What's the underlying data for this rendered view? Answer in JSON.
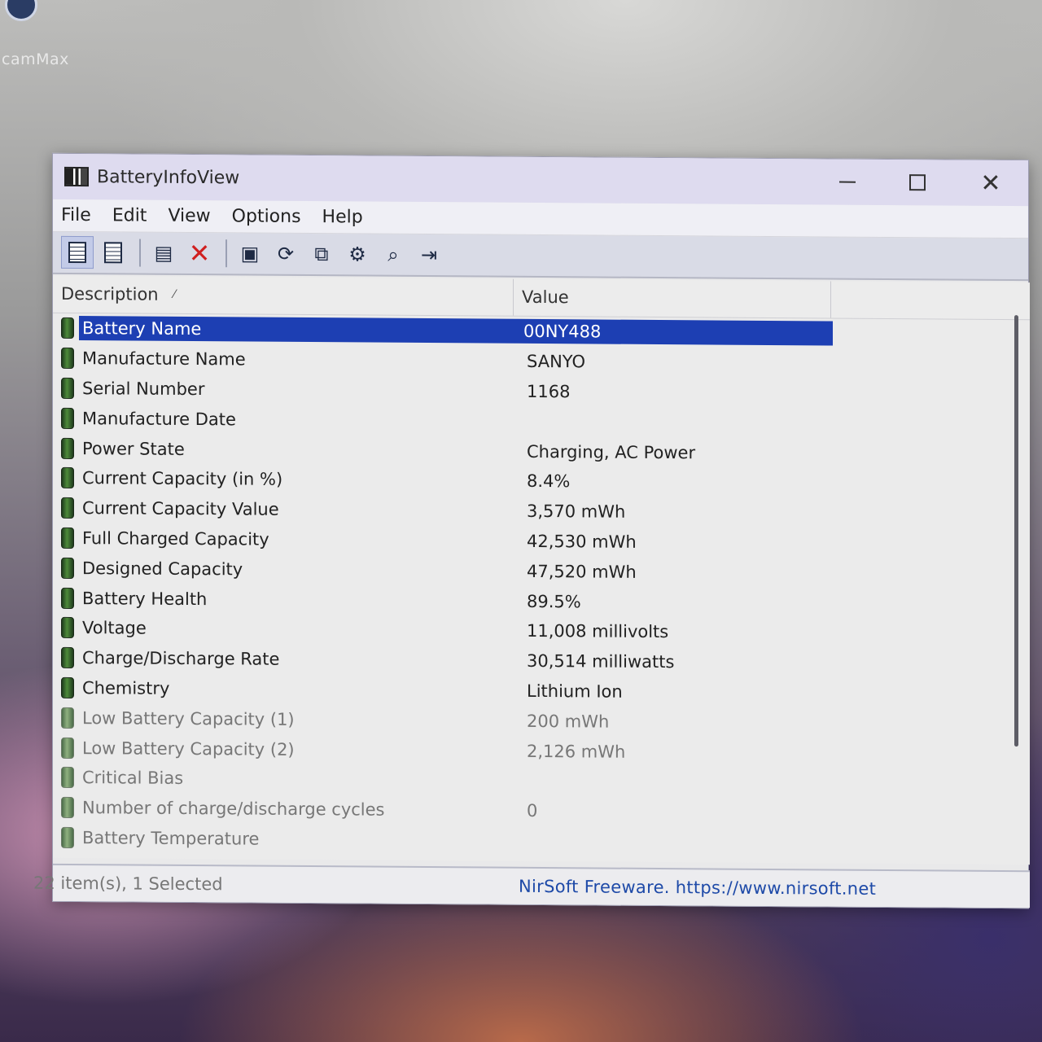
{
  "desktop": {
    "icon_label": "camMax"
  },
  "window": {
    "title": "BatteryInfoView",
    "caption": {
      "close": "✕"
    }
  },
  "menu": [
    "File",
    "Edit",
    "View",
    "Options",
    "Help"
  ],
  "toolbar": {
    "buttons": [
      "view-list-icon",
      "view-html-icon",
      "properties-icon",
      "delete-icon",
      "save-icon",
      "refresh-icon",
      "copy-icon",
      "settings-icon",
      "find-icon",
      "exit-icon"
    ]
  },
  "columns": {
    "description": "Description",
    "sort_mark": "⁄",
    "value": "Value"
  },
  "rows": [
    {
      "desc": "Battery Name",
      "value": "00NY488"
    },
    {
      "desc": "Manufacture Name",
      "value": "SANYO"
    },
    {
      "desc": "Serial Number",
      "value": " 1168"
    },
    {
      "desc": "Manufacture Date",
      "value": ""
    },
    {
      "desc": "Power State",
      "value": "Charging, AC Power"
    },
    {
      "desc": "Current Capacity (in %)",
      "value": "8.4%"
    },
    {
      "desc": "Current Capacity Value",
      "value": "3,570 mWh"
    },
    {
      "desc": "Full Charged Capacity",
      "value": "42,530 mWh"
    },
    {
      "desc": "Designed Capacity",
      "value": "47,520 mWh"
    },
    {
      "desc": "Battery Health",
      "value": "89.5%"
    },
    {
      "desc": "Voltage",
      "value": "11,008 millivolts"
    },
    {
      "desc": "Charge/Discharge Rate",
      "value": "30,514 milliwatts"
    },
    {
      "desc": "Chemistry",
      "value": "Lithium Ion"
    },
    {
      "desc": "Low Battery Capacity (1)",
      "value": "200 mWh"
    },
    {
      "desc": "Low Battery Capacity (2)",
      "value": "2,126 mWh"
    },
    {
      "desc": "Critical Bias",
      "value": ""
    },
    {
      "desc": "Number of charge/discharge cycles",
      "value": "0"
    },
    {
      "desc": "Battery Temperature",
      "value": ""
    }
  ],
  "status": {
    "items": "22 item(s), 1 Selected",
    "credit": "NirSoft Freeware. https://www.nirsoft.net"
  },
  "colors": {
    "selection": "#1d3fb3",
    "link": "#1e4aa8"
  }
}
